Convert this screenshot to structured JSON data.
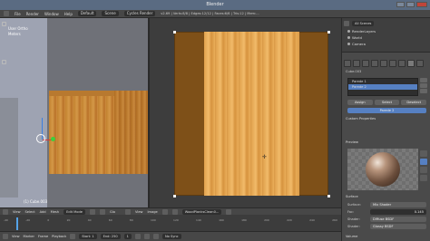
{
  "window": {
    "title": "Blender"
  },
  "infobar": {
    "menus": [
      "File",
      "Render",
      "Window",
      "Help"
    ],
    "layout": "Default",
    "scene": "Scene",
    "engine": "Cycles Render",
    "stats": "v2.69 | Verts:8/8 | Edges:12/12 | Faces:6/6 | Tris:12 | Mem:..."
  },
  "viewport": {
    "view_label": "User Ortho",
    "unit_label": "Meters",
    "object_label": "(1) Cube.003"
  },
  "outliner": {
    "search": "All Scenes",
    "rows": [
      "RenderLayers",
      "World",
      "Camera"
    ]
  },
  "properties": {
    "breadcrumb": "Cube.003",
    "materials": [
      "Parede 1",
      "Parede 2"
    ],
    "buttons": {
      "assign": "Assign",
      "select": "Select",
      "deselect": "Deselect"
    },
    "datablock": "Parede 2",
    "sections": {
      "custom_props": "Custom Properties",
      "preview": "Preview",
      "surface": "Surface",
      "volume": "Volume"
    },
    "surface": {
      "shader_label": "Surface:",
      "shader_value": "Mix Shader",
      "fac_label": "Fac:",
      "fac_value": "0.145",
      "shader1_label": "Shader:",
      "shader1_value": "Diffuse BSDF",
      "shader2_label": "Shader:",
      "shader2_value": "Glossy BSDF"
    }
  },
  "viewport_header": {
    "items": [
      "View",
      "Select",
      "Add",
      "Mesh"
    ],
    "mode": "Edit Mode",
    "global": "Glo"
  },
  "image_header": {
    "items": [
      "View",
      "Image"
    ],
    "image_name": "WoodPlanksClean0..."
  },
  "timeline": {
    "ticks": [
      "-40",
      "-20",
      "0",
      "20",
      "40",
      "60",
      "80",
      "100",
      "120",
      "140",
      "160",
      "180",
      "200",
      "220",
      "240",
      "260"
    ],
    "menus": [
      "View",
      "Marker",
      "Frame",
      "Playback"
    ],
    "start": "Start: 1",
    "end": "End: 250",
    "current": "1",
    "sync": "No Sync"
  }
}
